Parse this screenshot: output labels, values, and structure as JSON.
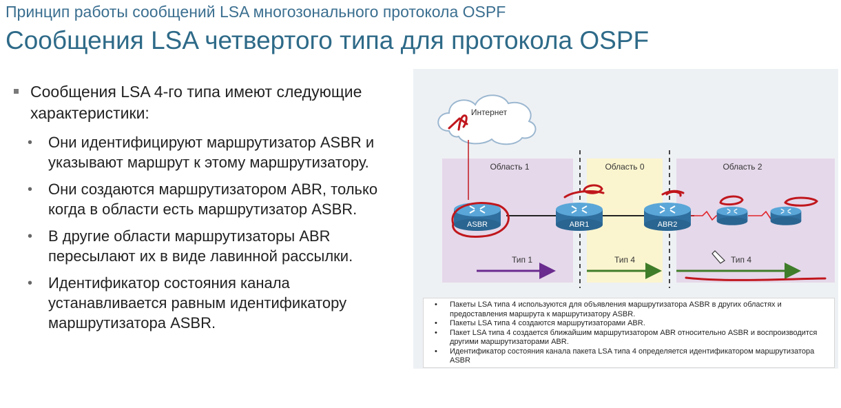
{
  "header": {
    "subtitle": "Принцип работы сообщений LSA многозонального протокола OSPF",
    "title": "Сообщения LSA четвертого типа для протокола OSPF"
  },
  "content": {
    "main_bullet": "Сообщения LSA 4-го типа имеют следующие характеристики:",
    "sub_bullets": [
      "Они идентифицируют маршрутизатор ASBR и указывают маршрут к этому маршрутизатору.",
      "Они создаются маршрутизатором ABR, только когда в области есть маршрутизатор ASBR.",
      "В другие области маршрутизаторы ABR пересылают их в виде лавинной рассылки.",
      "Идентификатор состояния канала устанавливается равным идентификатору маршрутизатора ASBR."
    ]
  },
  "diagram": {
    "cloud_label": "Интернет",
    "areas": [
      "Область 1",
      "Область 0",
      "Область 2"
    ],
    "routers": [
      "ASBR",
      "ABR1",
      "ABR2"
    ],
    "arrows": [
      "Тип 1",
      "Тип 4",
      "Тип 4"
    ],
    "colors": {
      "area1": "#e5d8ea",
      "area0": "#fbf5cf",
      "area2": "#e5d8ea",
      "router": "#3d8bc0",
      "arrow_type1": "#6a2c8e",
      "arrow_type4": "#3f7d2a",
      "annotation": "#c0171d",
      "serial_link": "#e0242a"
    },
    "caption": [
      "Пакеты LSA типа 4 используются для объявления маршрутизатора ASBR в других областях и предоставления маршрута к маршрутизатору ASBR.",
      "Пакеты LSA типа 4 создаются маршрутизаторами ABR.",
      "Пакет LSA типа 4 создается ближайшим маршрутизатором ABR относительно ASBR и воспроизводится другими маршрутизаторами ABR.",
      "Идентификатор состояния канала пакета LSA типа 4 определяется идентификатором маршрутизатора ASBR"
    ]
  }
}
